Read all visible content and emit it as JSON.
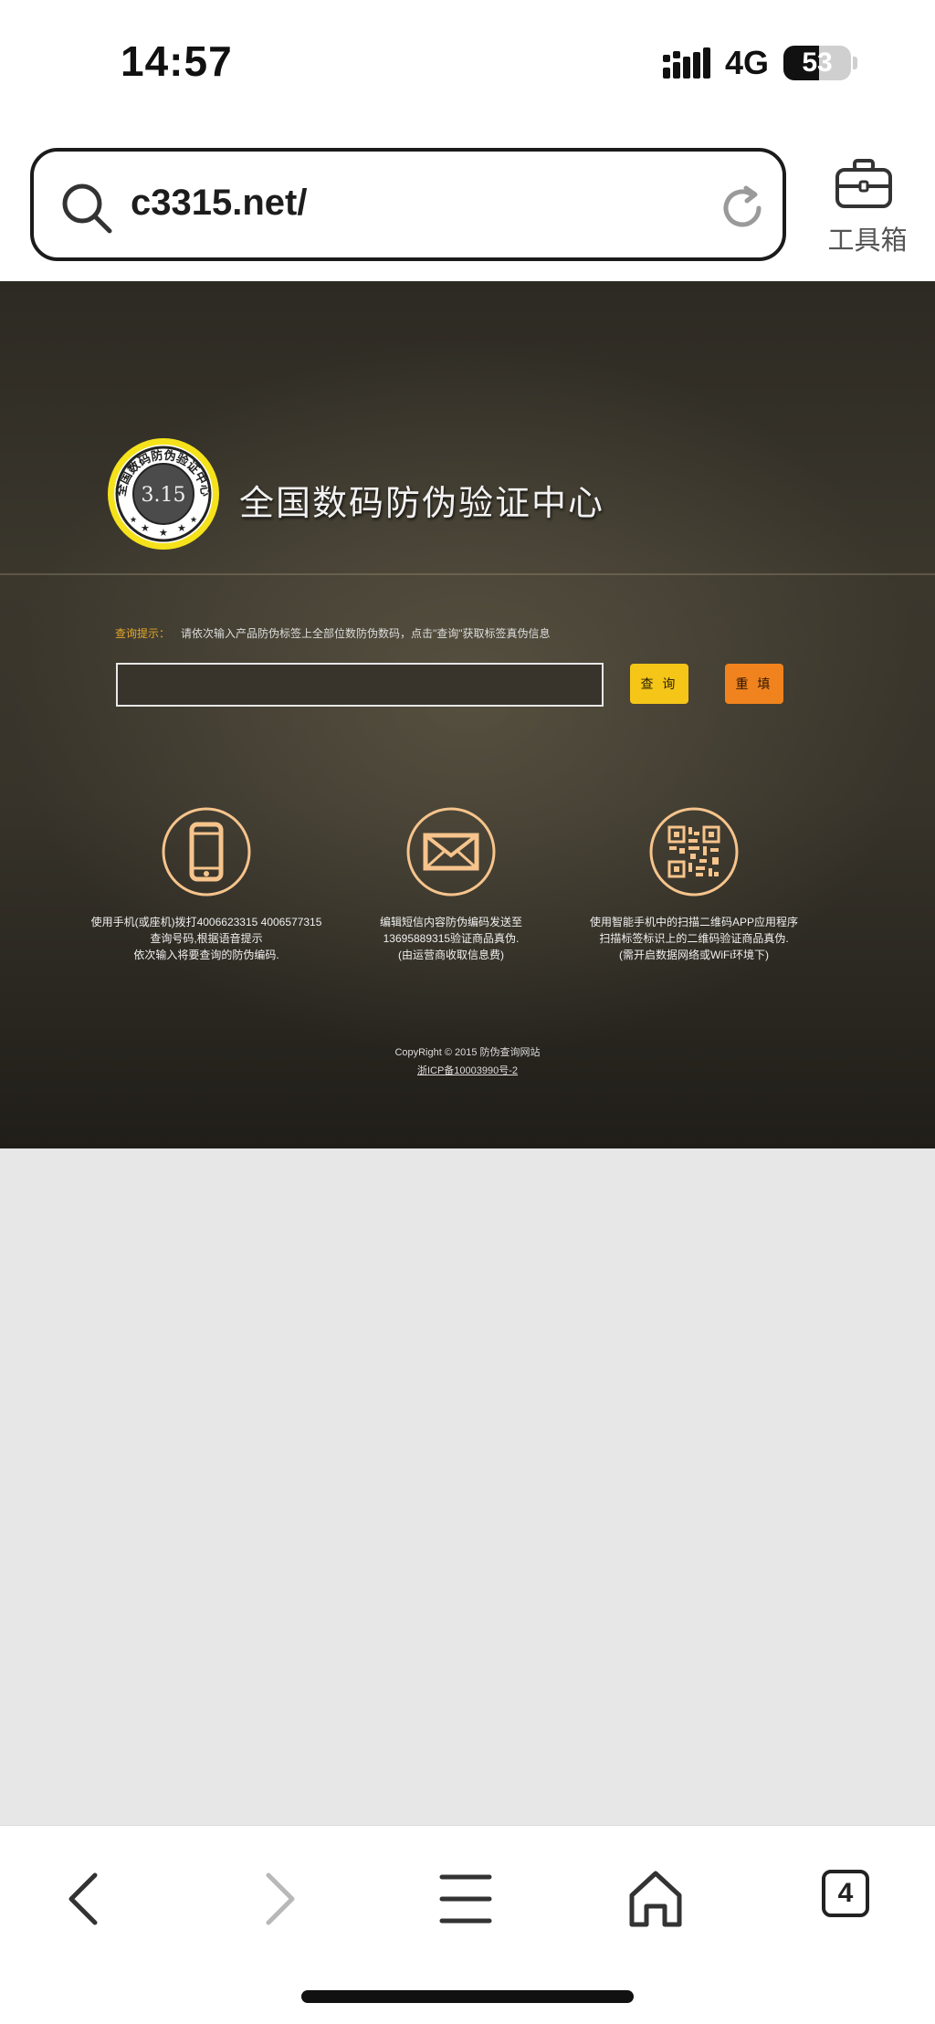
{
  "status_bar": {
    "time": "14:57",
    "network": "4G",
    "battery_level": "53",
    "battery_fraction": 0.53
  },
  "browser": {
    "url": "c3315.net/",
    "toolbox_label": "工具箱",
    "open_tabs": "4"
  },
  "page": {
    "seal": {
      "ring_text": "全国数码防伪验证中心",
      "center_text": "3.15"
    },
    "site_title": "全国数码防伪验证中心",
    "query_hint_label": "查询提示：",
    "query_hint_text": "请依次输入产品防伪标签上全部位数防伪数码，点击\"查询\"获取标签真伪信息",
    "query_input_value": "",
    "query_button": "查 询",
    "reset_button": "重 填",
    "methods": [
      {
        "icon": "phone-icon",
        "lines": [
          "使用手机(或座机)拨打4006623315 4006577315",
          "查询号码,根据语音提示",
          "依次输入将要查询的防伪编码."
        ]
      },
      {
        "icon": "envelope-icon",
        "lines": [
          "编辑短信内容防伪编码发送至",
          "13695889315验证商品真伪.",
          "(由运营商收取信息费)"
        ]
      },
      {
        "icon": "qr-code-icon",
        "lines": [
          "使用智能手机中的扫描二维码APP应用程序",
          "扫描标签标识上的二维码验证商品真伪.",
          "(需开启数据网络或WiFi环境下)"
        ]
      }
    ],
    "copyright": "CopyRight © 2015 防伪查询网站",
    "icp": "浙ICP备10003990号-2"
  },
  "colors": {
    "accent_gold": "#f5c518",
    "accent_orange": "#f0831e",
    "icon_peach": "#f6c48c"
  }
}
